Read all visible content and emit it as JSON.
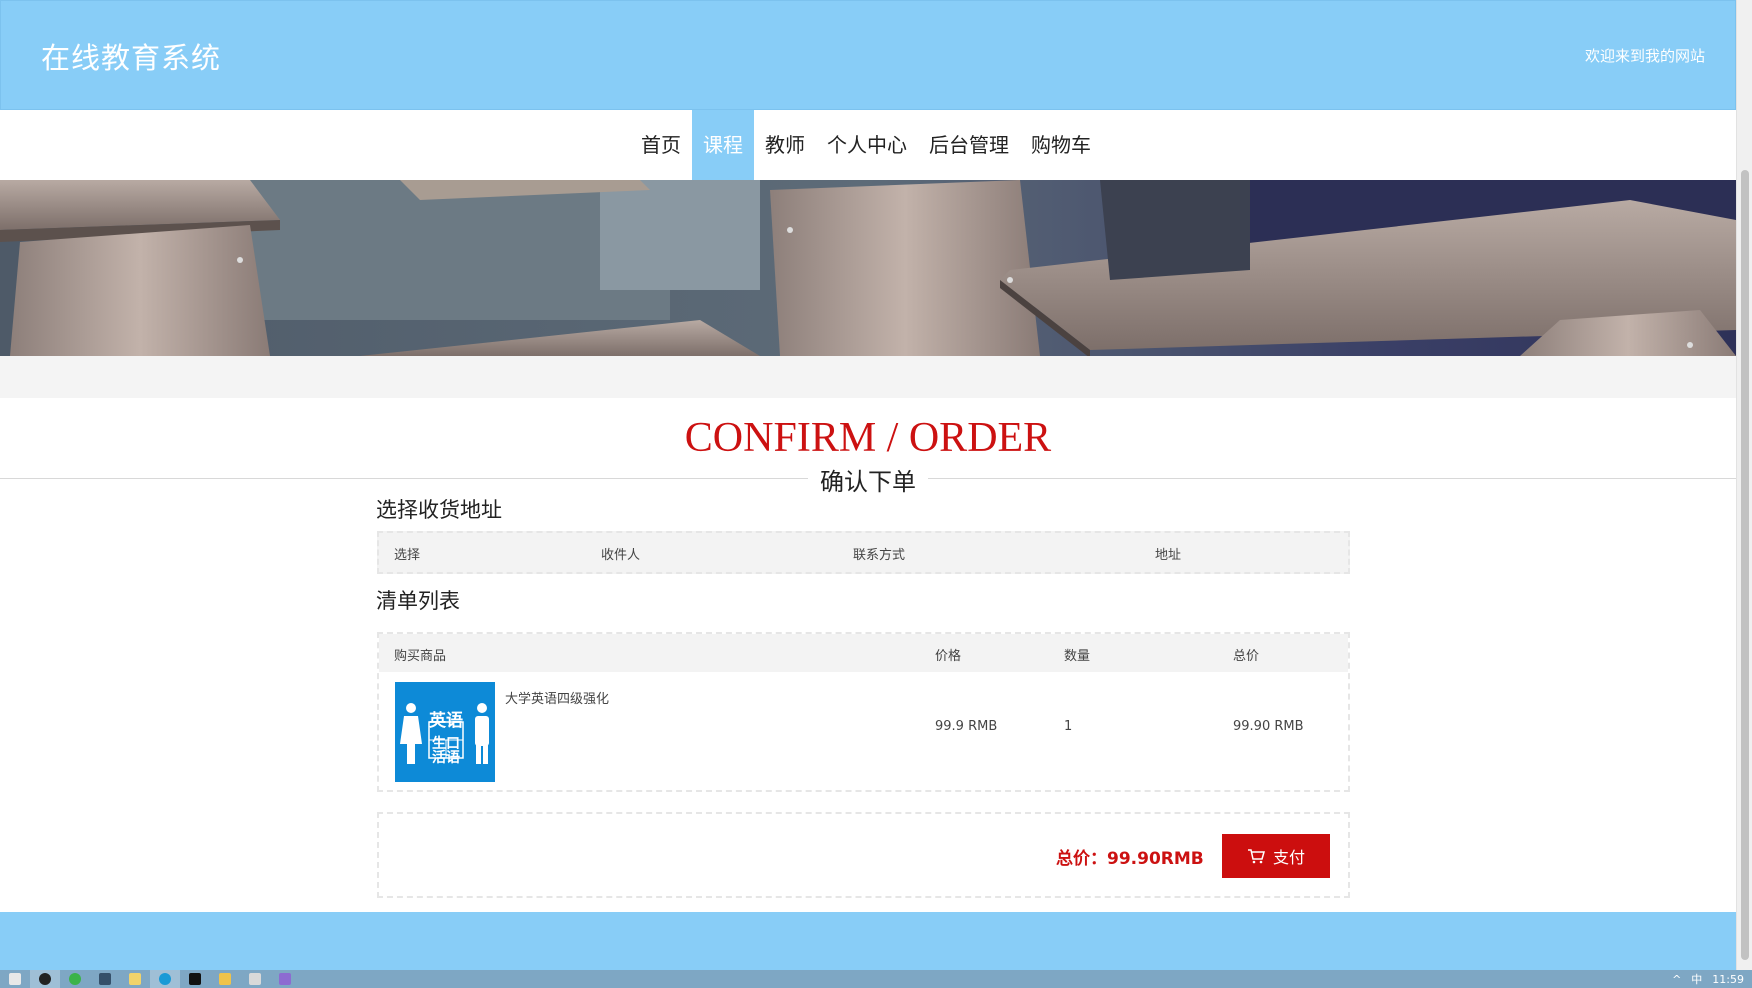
{
  "header": {
    "site_title": "在线教育系统",
    "welcome": "欢迎来到我的网站"
  },
  "nav": {
    "items": [
      {
        "label": "首页",
        "active": false
      },
      {
        "label": "课程",
        "active": true
      },
      {
        "label": "教师",
        "active": false
      },
      {
        "label": "个人中心",
        "active": false
      },
      {
        "label": "后台管理",
        "active": false
      },
      {
        "label": "购物车",
        "active": false
      }
    ]
  },
  "page": {
    "title": "CONFIRM / ORDER",
    "subtitle": "确认下单"
  },
  "address": {
    "section_title": "选择收货地址",
    "columns": [
      "选择",
      "收件人",
      "联系方式",
      "地址"
    ]
  },
  "order_list": {
    "section_title": "清单列表",
    "columns": [
      "购买商品",
      "价格",
      "数量",
      "总价"
    ],
    "items": [
      {
        "name": "大学英语四级强化",
        "price": "99.9 RMB",
        "quantity": "1",
        "total": "99.90 RMB",
        "thumb_text": [
          "英语",
          "生口",
          "活语"
        ]
      }
    ]
  },
  "payment": {
    "total_label": "总价：99.90RMB",
    "pay_button": "支付"
  },
  "taskbar": {
    "tray_ime": "中",
    "clock": "11:59"
  },
  "colors": {
    "header_bg": "#88cdf7",
    "accent_red": "#cc1111",
    "pay_button": "#cc0e0e",
    "thumb_bg": "#0d8ad7"
  }
}
